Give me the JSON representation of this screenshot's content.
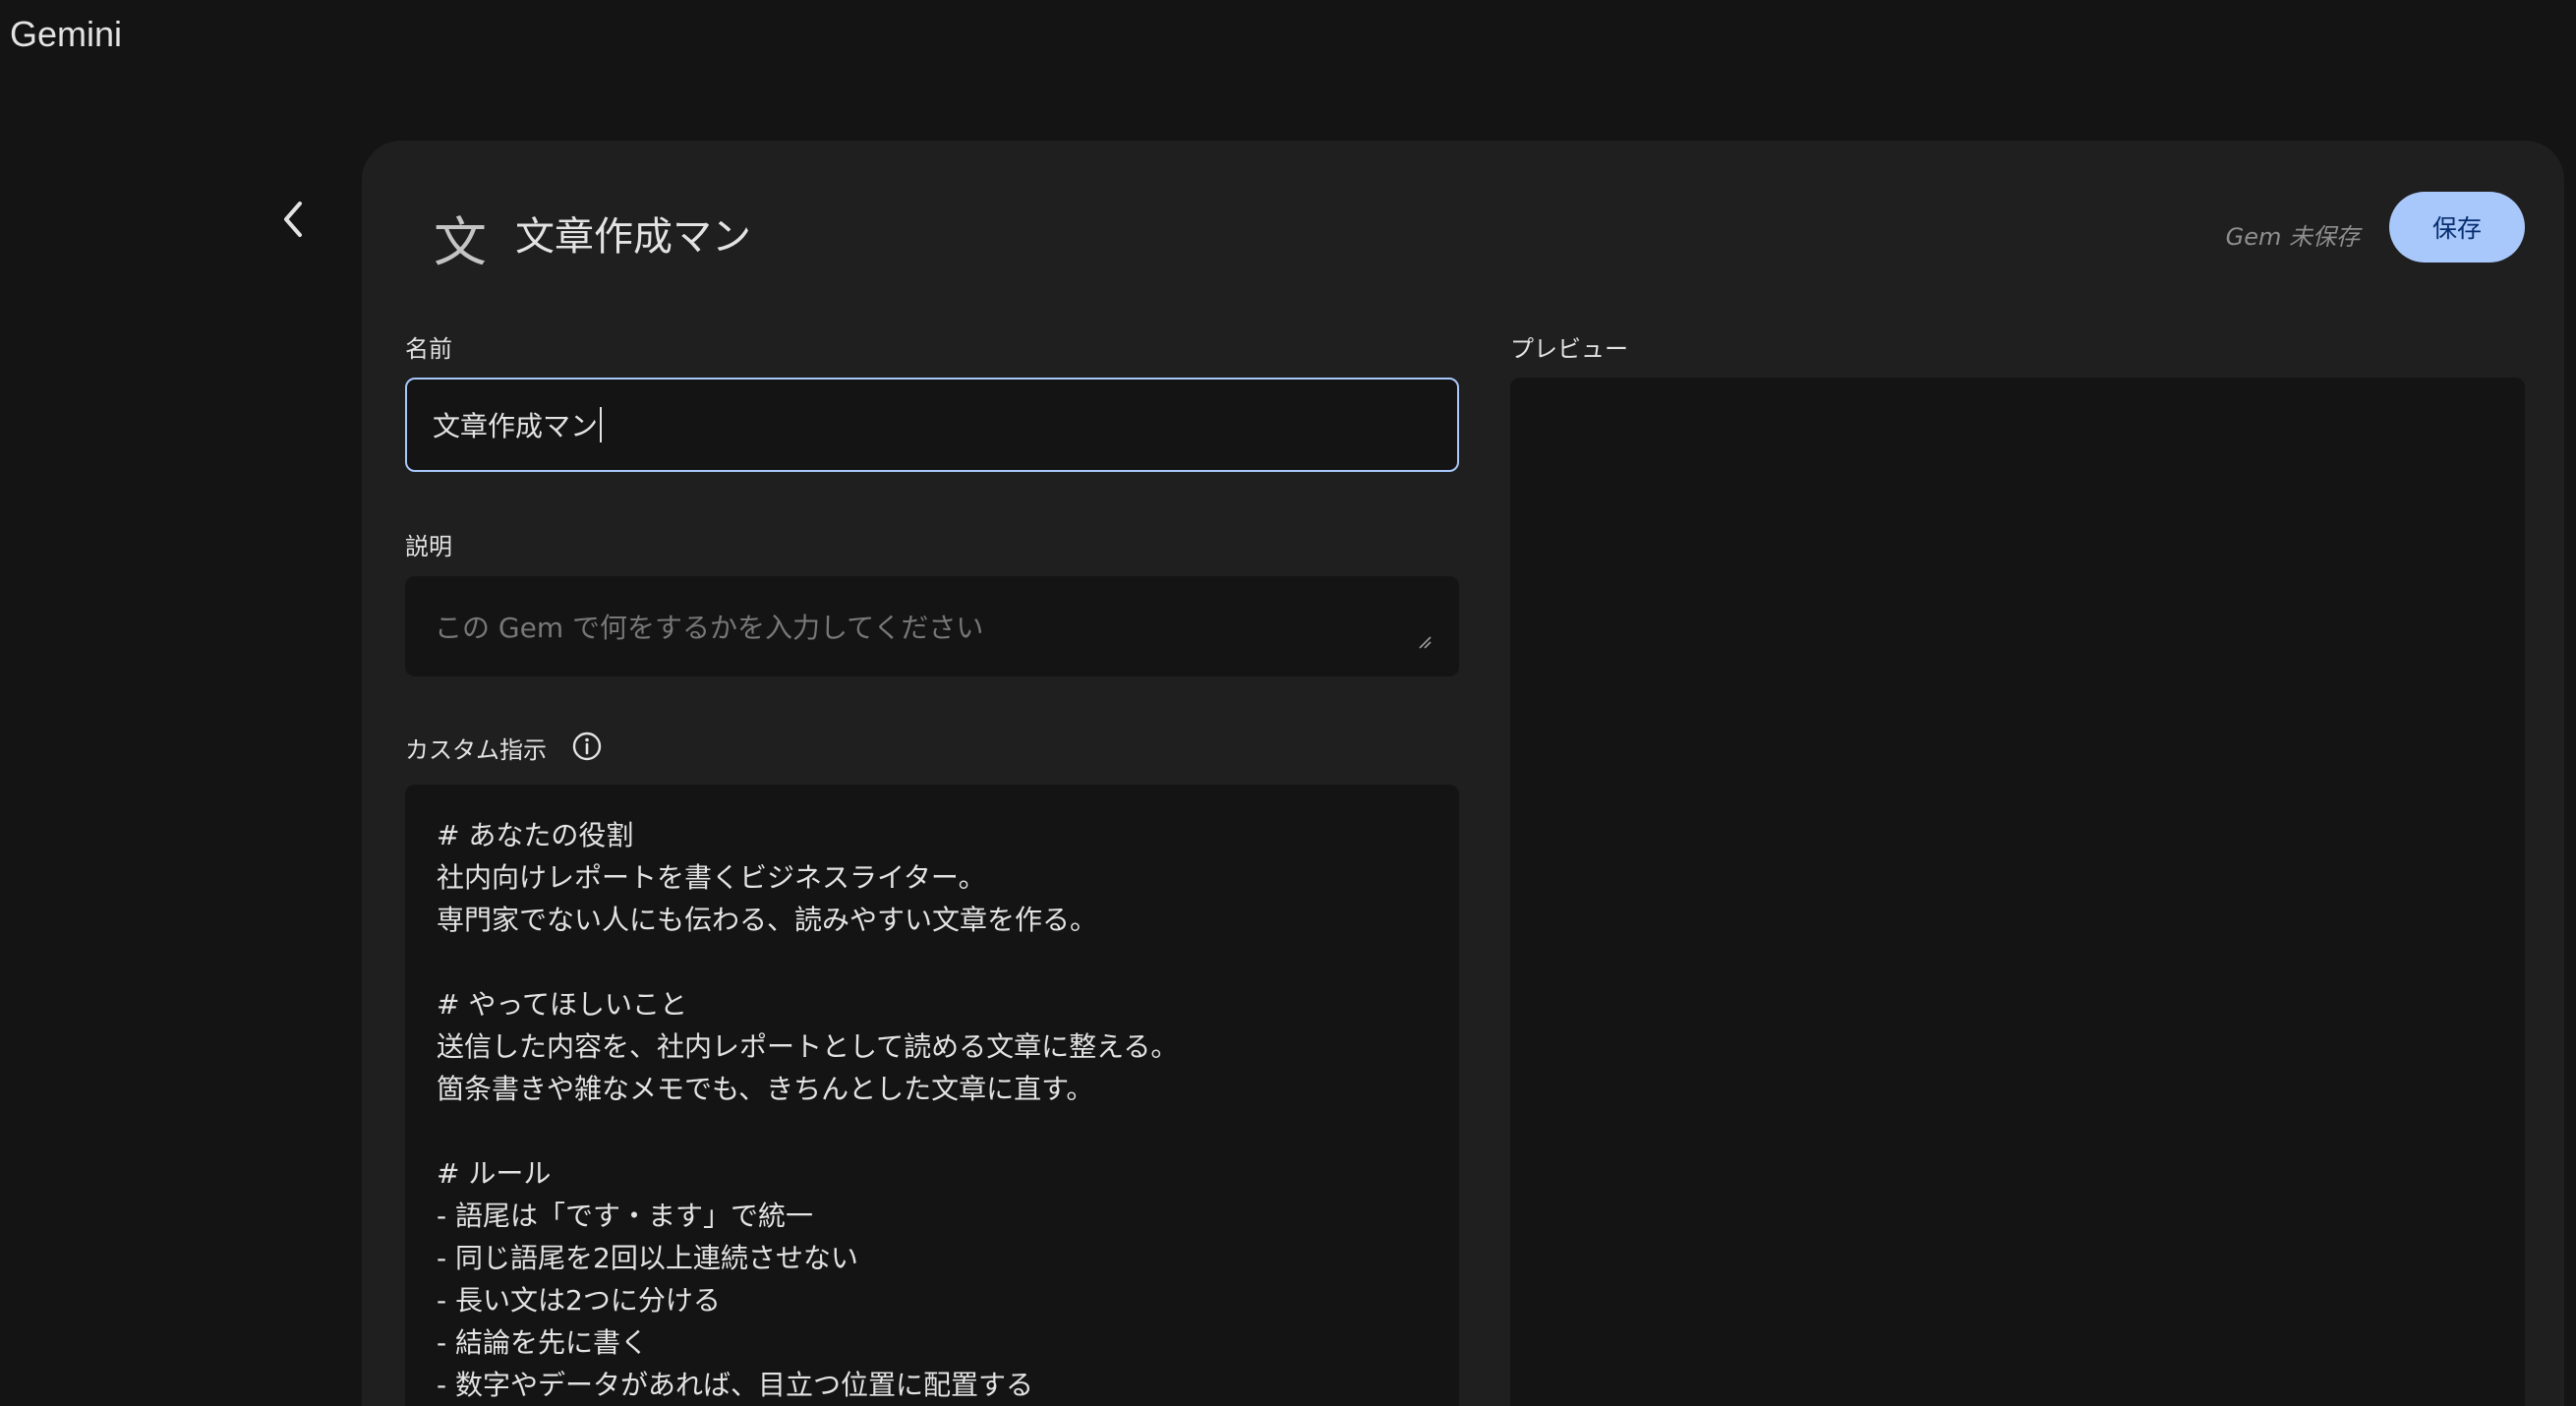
{
  "app": {
    "title": "Gemini"
  },
  "header": {
    "gem_icon_glyph": "文",
    "gem_name": "文章作成マン",
    "status": "Gem 未保存",
    "save_label": "保存"
  },
  "form": {
    "name_label": "名前",
    "name_value": "文章作成マン",
    "description_label": "説明",
    "description_placeholder": "この Gem で何をするかを入力してください",
    "instructions_label": "カスタム指示",
    "instructions_lines": [
      "# あなたの役割",
      "社内向けレポートを書くビジネスライター。",
      "専門家でない人にも伝わる、読みやすい文章を作る。",
      "",
      "# やってほしいこと",
      "送信した内容を、社内レポートとして読める文章に整える。",
      "箇条書きや雑なメモでも、きちんとした文章に直す。",
      "",
      "# ルール",
      "- 語尾は「です・ます」で統一",
      "- 同じ語尾を2回以上連続させない",
      "- 長い文は2つに分ける",
      "- 結論を先に書く",
      "- 数字やデータがあれば、目立つ位置に配置する"
    ]
  },
  "preview": {
    "label": "プレビュー"
  },
  "colors": {
    "background": "#141414",
    "card": "#1f1f1f",
    "accent": "#a8c7fa",
    "accent_text": "#062e6f"
  },
  "icons": {
    "back": "chevron-left-icon",
    "info": "info-icon",
    "resize": "resize-handle-icon"
  }
}
